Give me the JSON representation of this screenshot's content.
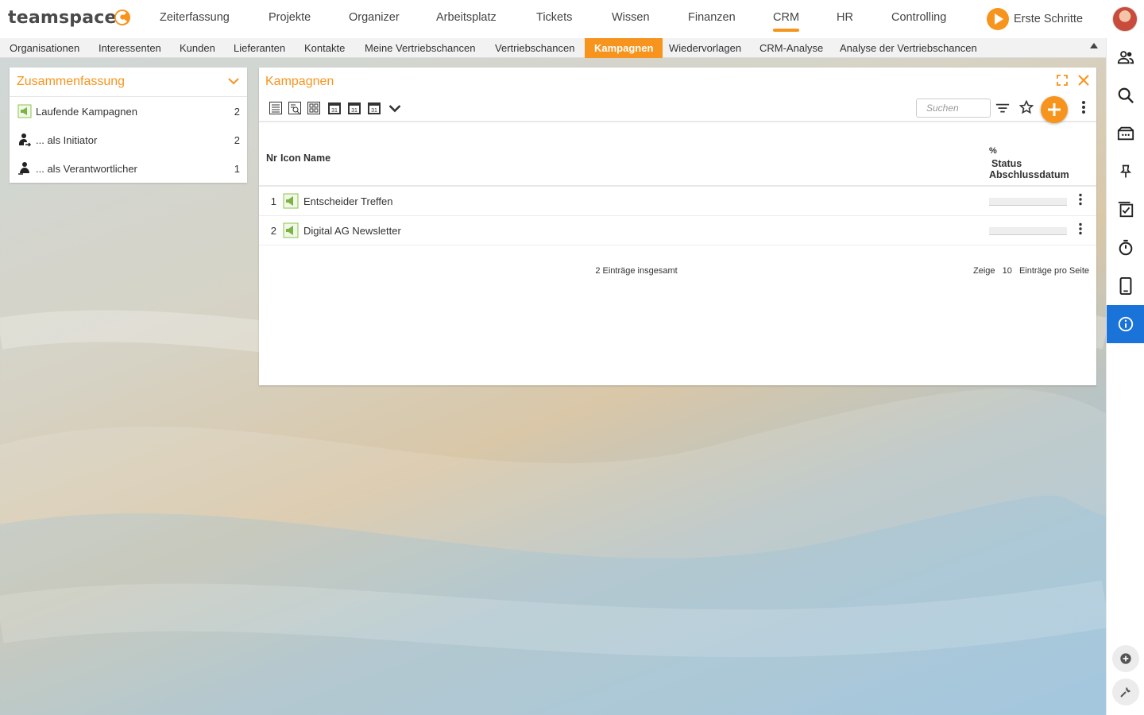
{
  "app": {
    "logo": "teamspace",
    "brand_color": "#f7941d",
    "accent_color": "#1a73d9"
  },
  "main_nav": [
    {
      "label": "Zeiterfassung",
      "active": false
    },
    {
      "label": "Projekte",
      "active": false
    },
    {
      "label": "Organizer",
      "active": false
    },
    {
      "label": "Arbeitsplatz",
      "active": false
    },
    {
      "label": "Tickets",
      "active": false
    },
    {
      "label": "Wissen",
      "active": false
    },
    {
      "label": "Finanzen",
      "active": false
    },
    {
      "label": "CRM",
      "active": true
    },
    {
      "label": "HR",
      "active": false
    },
    {
      "label": "Controlling",
      "active": false
    }
  ],
  "header": {
    "erste_schritte": "Erste Schritte",
    "avatar_icon": "user-avatar"
  },
  "sub_nav": [
    {
      "label": "Organisationen"
    },
    {
      "label": "Interessenten"
    },
    {
      "label": "Kunden"
    },
    {
      "label": "Lieferanten"
    },
    {
      "label": "Kontakte"
    },
    {
      "label": "Meine Vertriebschancen"
    },
    {
      "label": "Vertriebschancen"
    },
    {
      "label": "Kampagnen",
      "active": true
    },
    {
      "label": "Wiedervorlagen"
    },
    {
      "label": "CRM-Analyse"
    },
    {
      "label": "Analyse der Vertriebschancen"
    }
  ],
  "summary": {
    "title": "Zusammenfassung",
    "rows": [
      {
        "label": "Laufende Kampagnen",
        "count": "2",
        "icon": "campaign-icon"
      },
      {
        "label": "... als Initiator",
        "count": "2",
        "icon": "initiator-icon"
      },
      {
        "label": "... als Verantwortlicher",
        "count": "1",
        "icon": "responsible-icon"
      }
    ]
  },
  "campaigns": {
    "title": "Kampagnen",
    "search_placeholder": "Suchen",
    "columns": {
      "nr": "Nr",
      "icon": "Icon",
      "name": "Name",
      "percent": "%",
      "status": "Status",
      "closing_date": "Abschlussdatum"
    },
    "rows": [
      {
        "nr": "1",
        "name": "Entscheider Treffen"
      },
      {
        "nr": "2",
        "name": "Digital AG Newsletter"
      }
    ],
    "total": "2 Einträge insgesamt",
    "pager": {
      "show": "Zeige",
      "count": "10",
      "per_page": "Einträge pro Seite"
    }
  },
  "right_bar": [
    {
      "icon": "contacts-icon"
    },
    {
      "icon": "search-icon"
    },
    {
      "icon": "inbox-icon"
    },
    {
      "icon": "pin-icon"
    },
    {
      "icon": "tasks-icon"
    },
    {
      "icon": "timer-icon"
    },
    {
      "icon": "mobile-icon"
    },
    {
      "icon": "info-icon",
      "active": true
    }
  ]
}
